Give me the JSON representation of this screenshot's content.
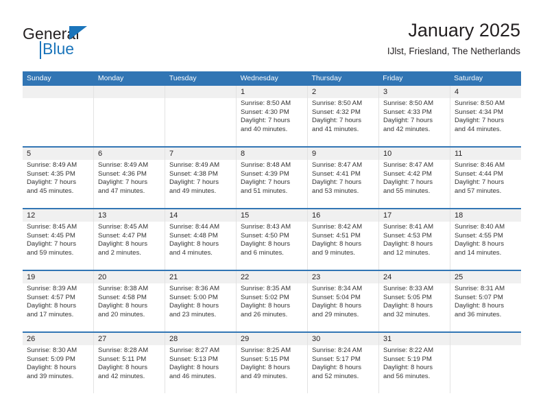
{
  "brand": {
    "name_part1": "General",
    "name_part2": "Blue"
  },
  "header": {
    "title": "January 2025",
    "subtitle": "IJlst, Friesland, The Netherlands"
  },
  "colors": {
    "header_blue": "#3175b4",
    "brand_blue": "#1b75bb",
    "number_band": "#f0f0f0",
    "cell_border": "#e2e2e2",
    "text": "#231f20"
  },
  "weekdays": [
    "Sunday",
    "Monday",
    "Tuesday",
    "Wednesday",
    "Thursday",
    "Friday",
    "Saturday"
  ],
  "weeks": [
    [
      {
        "day": "",
        "sunrise": "",
        "sunset": "",
        "daylight1": "",
        "daylight2": ""
      },
      {
        "day": "",
        "sunrise": "",
        "sunset": "",
        "daylight1": "",
        "daylight2": ""
      },
      {
        "day": "",
        "sunrise": "",
        "sunset": "",
        "daylight1": "",
        "daylight2": ""
      },
      {
        "day": "1",
        "sunrise": "Sunrise: 8:50 AM",
        "sunset": "Sunset: 4:30 PM",
        "daylight1": "Daylight: 7 hours",
        "daylight2": "and 40 minutes."
      },
      {
        "day": "2",
        "sunrise": "Sunrise: 8:50 AM",
        "sunset": "Sunset: 4:32 PM",
        "daylight1": "Daylight: 7 hours",
        "daylight2": "and 41 minutes."
      },
      {
        "day": "3",
        "sunrise": "Sunrise: 8:50 AM",
        "sunset": "Sunset: 4:33 PM",
        "daylight1": "Daylight: 7 hours",
        "daylight2": "and 42 minutes."
      },
      {
        "day": "4",
        "sunrise": "Sunrise: 8:50 AM",
        "sunset": "Sunset: 4:34 PM",
        "daylight1": "Daylight: 7 hours",
        "daylight2": "and 44 minutes."
      }
    ],
    [
      {
        "day": "5",
        "sunrise": "Sunrise: 8:49 AM",
        "sunset": "Sunset: 4:35 PM",
        "daylight1": "Daylight: 7 hours",
        "daylight2": "and 45 minutes."
      },
      {
        "day": "6",
        "sunrise": "Sunrise: 8:49 AM",
        "sunset": "Sunset: 4:36 PM",
        "daylight1": "Daylight: 7 hours",
        "daylight2": "and 47 minutes."
      },
      {
        "day": "7",
        "sunrise": "Sunrise: 8:49 AM",
        "sunset": "Sunset: 4:38 PM",
        "daylight1": "Daylight: 7 hours",
        "daylight2": "and 49 minutes."
      },
      {
        "day": "8",
        "sunrise": "Sunrise: 8:48 AM",
        "sunset": "Sunset: 4:39 PM",
        "daylight1": "Daylight: 7 hours",
        "daylight2": "and 51 minutes."
      },
      {
        "day": "9",
        "sunrise": "Sunrise: 8:47 AM",
        "sunset": "Sunset: 4:41 PM",
        "daylight1": "Daylight: 7 hours",
        "daylight2": "and 53 minutes."
      },
      {
        "day": "10",
        "sunrise": "Sunrise: 8:47 AM",
        "sunset": "Sunset: 4:42 PM",
        "daylight1": "Daylight: 7 hours",
        "daylight2": "and 55 minutes."
      },
      {
        "day": "11",
        "sunrise": "Sunrise: 8:46 AM",
        "sunset": "Sunset: 4:44 PM",
        "daylight1": "Daylight: 7 hours",
        "daylight2": "and 57 minutes."
      }
    ],
    [
      {
        "day": "12",
        "sunrise": "Sunrise: 8:45 AM",
        "sunset": "Sunset: 4:45 PM",
        "daylight1": "Daylight: 7 hours",
        "daylight2": "and 59 minutes."
      },
      {
        "day": "13",
        "sunrise": "Sunrise: 8:45 AM",
        "sunset": "Sunset: 4:47 PM",
        "daylight1": "Daylight: 8 hours",
        "daylight2": "and 2 minutes."
      },
      {
        "day": "14",
        "sunrise": "Sunrise: 8:44 AM",
        "sunset": "Sunset: 4:48 PM",
        "daylight1": "Daylight: 8 hours",
        "daylight2": "and 4 minutes."
      },
      {
        "day": "15",
        "sunrise": "Sunrise: 8:43 AM",
        "sunset": "Sunset: 4:50 PM",
        "daylight1": "Daylight: 8 hours",
        "daylight2": "and 6 minutes."
      },
      {
        "day": "16",
        "sunrise": "Sunrise: 8:42 AM",
        "sunset": "Sunset: 4:51 PM",
        "daylight1": "Daylight: 8 hours",
        "daylight2": "and 9 minutes."
      },
      {
        "day": "17",
        "sunrise": "Sunrise: 8:41 AM",
        "sunset": "Sunset: 4:53 PM",
        "daylight1": "Daylight: 8 hours",
        "daylight2": "and 12 minutes."
      },
      {
        "day": "18",
        "sunrise": "Sunrise: 8:40 AM",
        "sunset": "Sunset: 4:55 PM",
        "daylight1": "Daylight: 8 hours",
        "daylight2": "and 14 minutes."
      }
    ],
    [
      {
        "day": "19",
        "sunrise": "Sunrise: 8:39 AM",
        "sunset": "Sunset: 4:57 PM",
        "daylight1": "Daylight: 8 hours",
        "daylight2": "and 17 minutes."
      },
      {
        "day": "20",
        "sunrise": "Sunrise: 8:38 AM",
        "sunset": "Sunset: 4:58 PM",
        "daylight1": "Daylight: 8 hours",
        "daylight2": "and 20 minutes."
      },
      {
        "day": "21",
        "sunrise": "Sunrise: 8:36 AM",
        "sunset": "Sunset: 5:00 PM",
        "daylight1": "Daylight: 8 hours",
        "daylight2": "and 23 minutes."
      },
      {
        "day": "22",
        "sunrise": "Sunrise: 8:35 AM",
        "sunset": "Sunset: 5:02 PM",
        "daylight1": "Daylight: 8 hours",
        "daylight2": "and 26 minutes."
      },
      {
        "day": "23",
        "sunrise": "Sunrise: 8:34 AM",
        "sunset": "Sunset: 5:04 PM",
        "daylight1": "Daylight: 8 hours",
        "daylight2": "and 29 minutes."
      },
      {
        "day": "24",
        "sunrise": "Sunrise: 8:33 AM",
        "sunset": "Sunset: 5:05 PM",
        "daylight1": "Daylight: 8 hours",
        "daylight2": "and 32 minutes."
      },
      {
        "day": "25",
        "sunrise": "Sunrise: 8:31 AM",
        "sunset": "Sunset: 5:07 PM",
        "daylight1": "Daylight: 8 hours",
        "daylight2": "and 36 minutes."
      }
    ],
    [
      {
        "day": "26",
        "sunrise": "Sunrise: 8:30 AM",
        "sunset": "Sunset: 5:09 PM",
        "daylight1": "Daylight: 8 hours",
        "daylight2": "and 39 minutes."
      },
      {
        "day": "27",
        "sunrise": "Sunrise: 8:28 AM",
        "sunset": "Sunset: 5:11 PM",
        "daylight1": "Daylight: 8 hours",
        "daylight2": "and 42 minutes."
      },
      {
        "day": "28",
        "sunrise": "Sunrise: 8:27 AM",
        "sunset": "Sunset: 5:13 PM",
        "daylight1": "Daylight: 8 hours",
        "daylight2": "and 46 minutes."
      },
      {
        "day": "29",
        "sunrise": "Sunrise: 8:25 AM",
        "sunset": "Sunset: 5:15 PM",
        "daylight1": "Daylight: 8 hours",
        "daylight2": "and 49 minutes."
      },
      {
        "day": "30",
        "sunrise": "Sunrise: 8:24 AM",
        "sunset": "Sunset: 5:17 PM",
        "daylight1": "Daylight: 8 hours",
        "daylight2": "and 52 minutes."
      },
      {
        "day": "31",
        "sunrise": "Sunrise: 8:22 AM",
        "sunset": "Sunset: 5:19 PM",
        "daylight1": "Daylight: 8 hours",
        "daylight2": "and 56 minutes."
      },
      {
        "day": "",
        "sunrise": "",
        "sunset": "",
        "daylight1": "",
        "daylight2": ""
      }
    ]
  ]
}
